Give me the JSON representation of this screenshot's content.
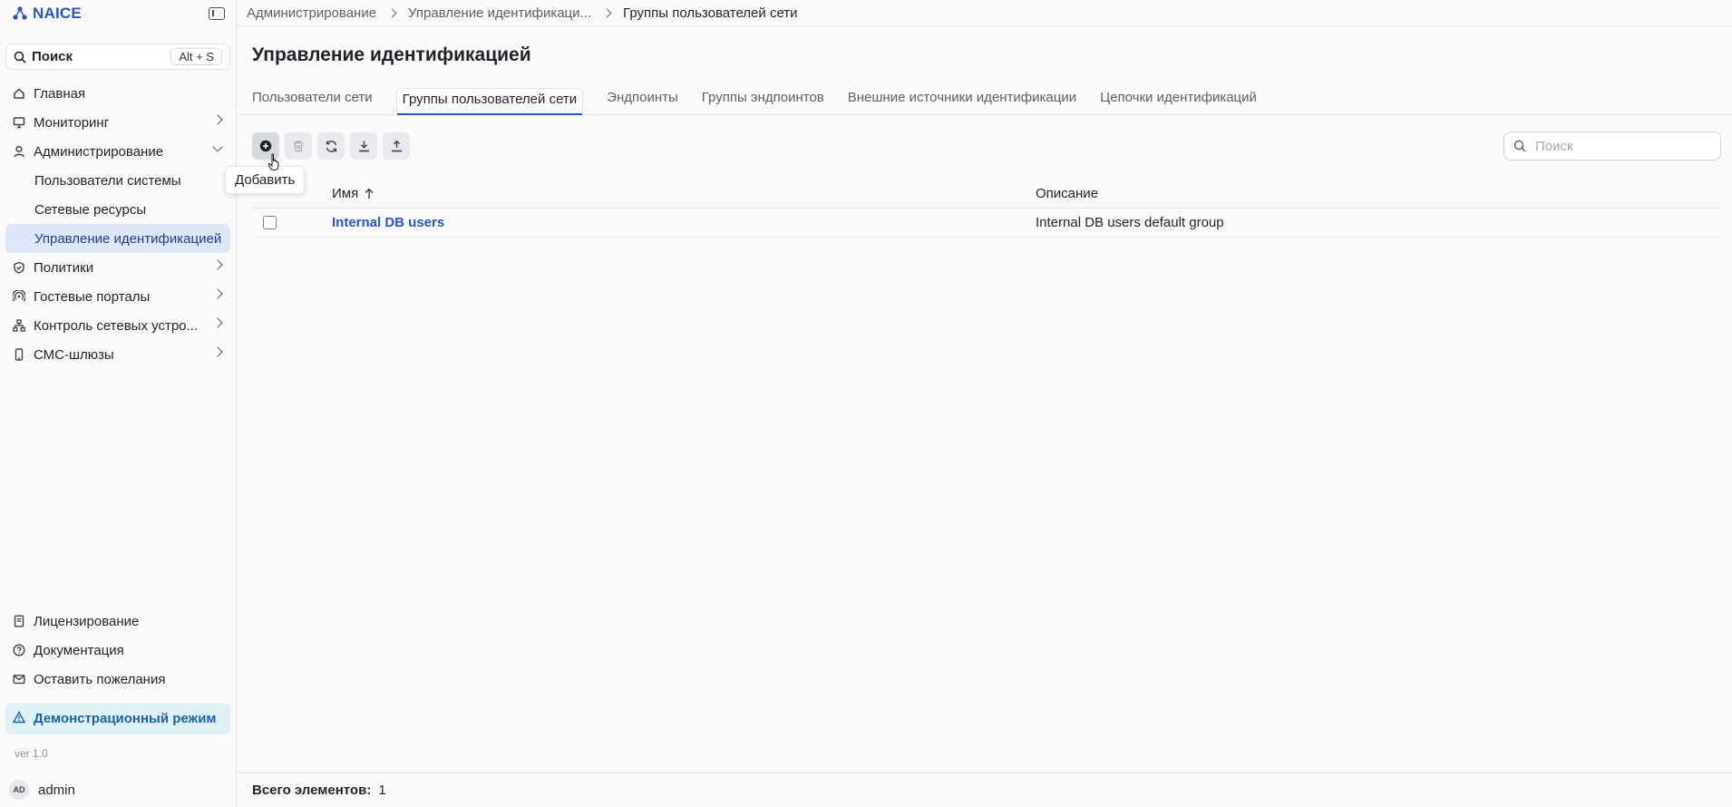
{
  "app": {
    "title": "NAICE",
    "version": "ver 1.0"
  },
  "sidebar": {
    "search_label": "Поиск",
    "search_shortcut": "Alt + S",
    "items": [
      {
        "label": "Главная",
        "icon": "home-icon"
      },
      {
        "label": "Мониторинг",
        "icon": "monitor-icon"
      },
      {
        "label": "Администрирование",
        "icon": "user-icon",
        "expanded": true
      },
      {
        "label": "Политики",
        "icon": "shield-check-icon"
      },
      {
        "label": "Гостевые порталы",
        "icon": "wifi-icon"
      },
      {
        "label": "Контроль сетевых устро...",
        "icon": "network-icon"
      },
      {
        "label": "СМС-шлюзы",
        "icon": "phone-icon"
      }
    ],
    "sub_items": [
      {
        "label": "Пользователи системы"
      },
      {
        "label": "Сетевые ресурсы"
      },
      {
        "label": "Управление идентификацией",
        "active": true
      }
    ],
    "bottom": [
      {
        "label": "Лицензирование",
        "icon": "license-icon"
      },
      {
        "label": "Документация",
        "icon": "help-icon"
      },
      {
        "label": "Оставить пожелания",
        "icon": "mail-icon"
      }
    ],
    "demo_label": "Демонстрационный режим",
    "user": {
      "initials": "AD",
      "name": "admin"
    }
  },
  "breadcrumb": [
    "Администрирование",
    "Управление идентификаци...",
    "Группы пользователей сети"
  ],
  "page": {
    "title": "Управление идентификацией"
  },
  "tabs": [
    {
      "label": "Пользователи сети"
    },
    {
      "label": "Группы пользователей сети",
      "active": true
    },
    {
      "label": "Эндпоинты"
    },
    {
      "label": "Группы эндпоинтов"
    },
    {
      "label": "Внешние источники идентификации"
    },
    {
      "label": "Цепочки идентификаций"
    }
  ],
  "toolbar": {
    "tooltip": "Добавить",
    "search_placeholder": "Поиск"
  },
  "table": {
    "columns": {
      "name": "Имя",
      "description": "Описание"
    },
    "rows": [
      {
        "name": "Internal DB users",
        "description": "Internal DB users default group"
      }
    ]
  },
  "footer": {
    "total_label": "Всего элементов:",
    "total_value": "1"
  },
  "colors": {
    "accent": "#2a55c9",
    "active_bg": "#dde7f7",
    "demo_bg": "#dff1f7"
  }
}
